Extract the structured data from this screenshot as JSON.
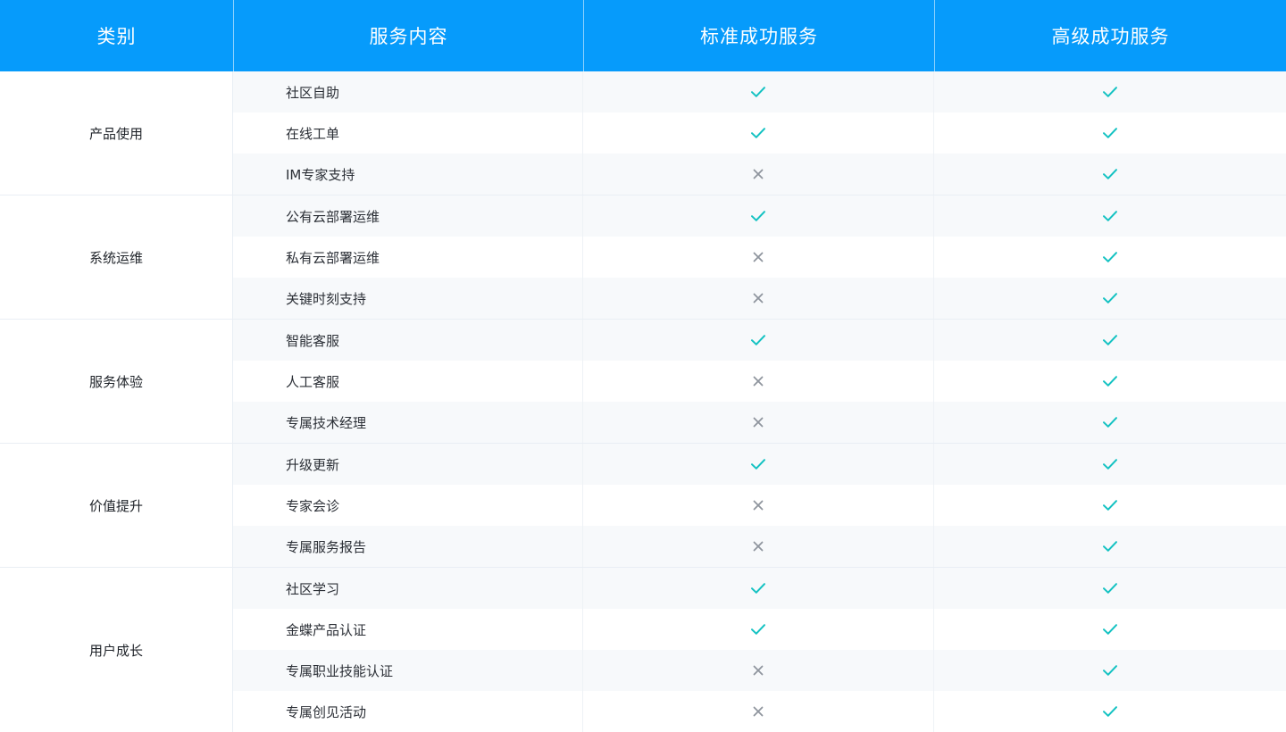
{
  "header": {
    "col_category": "类别",
    "col_service": "服务内容",
    "col_standard": "标准成功服务",
    "col_advanced": "高级成功服务"
  },
  "colors": {
    "header_bg": "#069bfb",
    "check": "#13c2c2",
    "cross": "#8f959e"
  },
  "groups": [
    {
      "category": "产品使用",
      "rows": [
        {
          "service": "社区自助",
          "standard": "check-icon",
          "advanced": "check-icon"
        },
        {
          "service": "在线工单",
          "standard": "check-icon",
          "advanced": "check-icon"
        },
        {
          "service": "IM专家支持",
          "standard": "cross-icon",
          "advanced": "check-icon"
        }
      ]
    },
    {
      "category": "系统运维",
      "rows": [
        {
          "service": "公有云部署运维",
          "standard": "check-icon",
          "advanced": "check-icon"
        },
        {
          "service": "私有云部署运维",
          "standard": "cross-icon",
          "advanced": "check-icon"
        },
        {
          "service": "关键时刻支持",
          "standard": "cross-icon",
          "advanced": "check-icon"
        }
      ]
    },
    {
      "category": "服务体验",
      "rows": [
        {
          "service": "智能客服",
          "standard": "check-icon",
          "advanced": "check-icon"
        },
        {
          "service": "人工客服",
          "standard": "cross-icon",
          "advanced": "check-icon"
        },
        {
          "service": "专属技术经理",
          "standard": "cross-icon",
          "advanced": "check-icon"
        }
      ]
    },
    {
      "category": "价值提升",
      "rows": [
        {
          "service": "升级更新",
          "standard": "check-icon",
          "advanced": "check-icon"
        },
        {
          "service": "专家会诊",
          "standard": "cross-icon",
          "advanced": "check-icon"
        },
        {
          "service": "专属服务报告",
          "standard": "cross-icon",
          "advanced": "check-icon"
        }
      ]
    },
    {
      "category": "用户成长",
      "rows": [
        {
          "service": "社区学习",
          "standard": "check-icon",
          "advanced": "check-icon"
        },
        {
          "service": "金蝶产品认证",
          "standard": "check-icon",
          "advanced": "check-icon"
        },
        {
          "service": "专属职业技能认证",
          "standard": "cross-icon",
          "advanced": "check-icon"
        },
        {
          "service": "专属创见活动",
          "standard": "cross-icon",
          "advanced": "check-icon"
        }
      ]
    }
  ]
}
